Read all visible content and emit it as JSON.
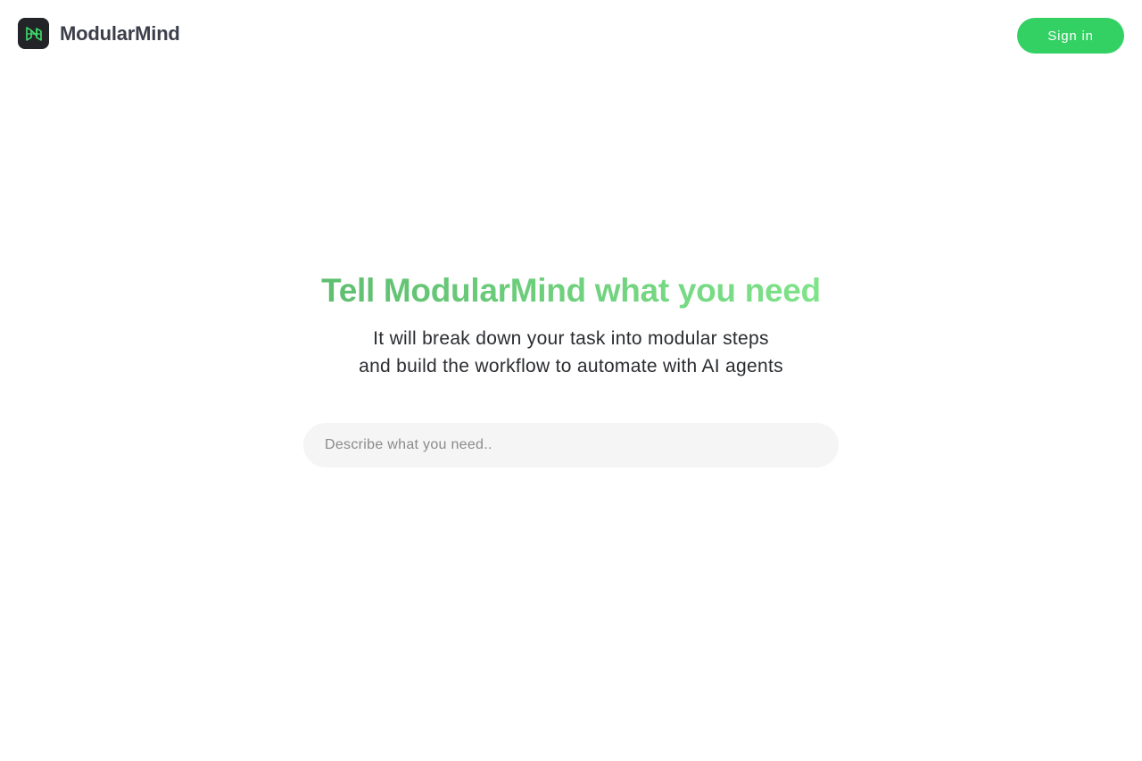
{
  "header": {
    "brand_name": "ModularMind",
    "logo_icon": "modular-cube-icon",
    "signin_label": "Sign in"
  },
  "hero": {
    "headline": "Tell ModularMind what you need",
    "subtitle_line1": "It will break down your task into modular steps",
    "subtitle_line2": "and build the workflow to automate with AI agents"
  },
  "search": {
    "placeholder": "Describe what you need..",
    "value": ""
  },
  "colors": {
    "accent": "#33d164",
    "headline_gradient_start": "#5fbe70",
    "headline_gradient_end": "#7fe38a",
    "logo_bg": "#222428",
    "input_bg": "#f5f5f5"
  }
}
